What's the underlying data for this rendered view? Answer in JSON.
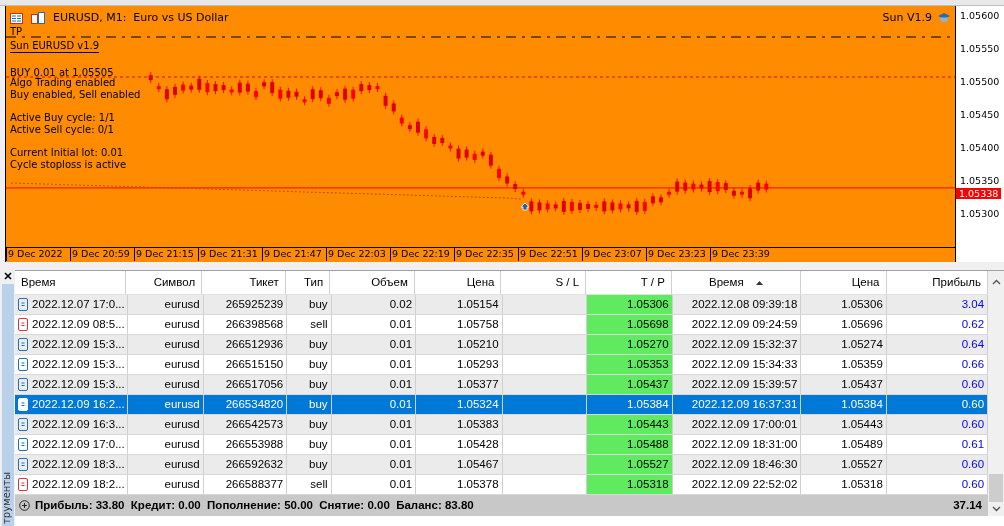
{
  "chart": {
    "title": "EURUSD, M1:  Euro vs US Dollar",
    "expert": "Sun V1.9",
    "tp_label": "TP",
    "indicator_title": "Sun EURUSD v1.9",
    "overlay_blocks": [
      [
        "BUY 0.01 at 1.05505",
        "Algo Trading enabled",
        "Buy enabled, Sell enabled"
      ],
      [
        "Active Buy cycle: 1/1",
        "Active Sell cycle: 0/1"
      ],
      [
        "Current Initial lot: 0.01",
        "Cycle stoploss is active"
      ]
    ],
    "price_labels": [
      "1.05600",
      "1.05550",
      "1.05500",
      "1.05450",
      "1.05400",
      "1.05350",
      "1.05300"
    ],
    "current_price": "1.05338",
    "time_labels": [
      "9 Dec 2022",
      "9 Dec 20:59",
      "9 Dec 21:15",
      "9 Dec 21:31",
      "9 Dec 21:47",
      "9 Dec 22:03",
      "9 Dec 22:19",
      "9 Dec 22:35",
      "9 Dec 22:51",
      "9 Dec 23:07",
      "9 Dec 23:23",
      "9 Dec 23:39"
    ]
  },
  "side_tab": "трументы",
  "table": {
    "columns": [
      {
        "label": "Время",
        "sorted": false
      },
      {
        "label": "Символ",
        "sorted": false
      },
      {
        "label": "Тикет",
        "sorted": false
      },
      {
        "label": "Тип",
        "sorted": false
      },
      {
        "label": "Объем",
        "sorted": false
      },
      {
        "label": "Цена",
        "sorted": false
      },
      {
        "label": "S / L",
        "sorted": false
      },
      {
        "label": "T / P",
        "sorted": false
      },
      {
        "label": "Время",
        "sorted": true
      },
      {
        "label": "Цена",
        "sorted": false
      },
      {
        "label": "Прибыль",
        "sorted": false
      }
    ],
    "rows": [
      {
        "kind": "buy",
        "selected": false,
        "cells": [
          "2022.12.07 17:0...",
          "eurusd",
          "265925239",
          "buy",
          "0.02",
          "1.05154",
          "",
          "1.05306",
          "2022.12.08 09:39:18",
          "1.05306",
          "3.04"
        ]
      },
      {
        "kind": "sell",
        "selected": false,
        "cells": [
          "2022.12.09 08:5...",
          "eurusd",
          "266398568",
          "sell",
          "0.01",
          "1.05758",
          "",
          "1.05698",
          "2022.12.09 09:24:59",
          "1.05696",
          "0.62"
        ]
      },
      {
        "kind": "buy",
        "selected": false,
        "cells": [
          "2022.12.09 15:3...",
          "eurusd",
          "266512936",
          "buy",
          "0.01",
          "1.05210",
          "",
          "1.05270",
          "2022.12.09 15:32:37",
          "1.05274",
          "0.64"
        ]
      },
      {
        "kind": "buy",
        "selected": false,
        "cells": [
          "2022.12.09 15:3...",
          "eurusd",
          "266515150",
          "buy",
          "0.01",
          "1.05293",
          "",
          "1.05353",
          "2022.12.09 15:34:33",
          "1.05359",
          "0.66"
        ]
      },
      {
        "kind": "buy",
        "selected": false,
        "cells": [
          "2022.12.09 15:3...",
          "eurusd",
          "266517056",
          "buy",
          "0.01",
          "1.05377",
          "",
          "1.05437",
          "2022.12.09 15:39:57",
          "1.05437",
          "0.60"
        ]
      },
      {
        "kind": "buy",
        "selected": true,
        "cells": [
          "2022.12.09 16:2...",
          "eurusd",
          "266534820",
          "buy",
          "0.01",
          "1.05324",
          "",
          "1.05384",
          "2022.12.09 16:37:31",
          "1.05384",
          "0.60"
        ]
      },
      {
        "kind": "buy",
        "selected": false,
        "cells": [
          "2022.12.09 16:3...",
          "eurusd",
          "266542573",
          "buy",
          "0.01",
          "1.05383",
          "",
          "1.05443",
          "2022.12.09 17:00:01",
          "1.05443",
          "0.60"
        ]
      },
      {
        "kind": "buy",
        "selected": false,
        "cells": [
          "2022.12.09 17:0...",
          "eurusd",
          "266553988",
          "buy",
          "0.01",
          "1.05428",
          "",
          "1.05488",
          "2022.12.09 18:31:00",
          "1.05489",
          "0.61"
        ]
      },
      {
        "kind": "buy",
        "selected": false,
        "cells": [
          "2022.12.09 18:3...",
          "eurusd",
          "266592632",
          "buy",
          "0.01",
          "1.05467",
          "",
          "1.05527",
          "2022.12.09 18:46:30",
          "1.05527",
          "0.60"
        ]
      },
      {
        "kind": "sell",
        "selected": false,
        "cells": [
          "2022.12.09 18:2...",
          "eurusd",
          "266588377",
          "sell",
          "0.01",
          "1.05378",
          "",
          "1.05318",
          "2022.12.09 22:52:02",
          "1.05318",
          "0.60"
        ]
      }
    ],
    "summary": "Прибыль: 33.80  Кредит: 0.00  Пополнение: 50.00  Снятие: 0.00  Баланс: 83.80",
    "total": "37.14"
  }
}
